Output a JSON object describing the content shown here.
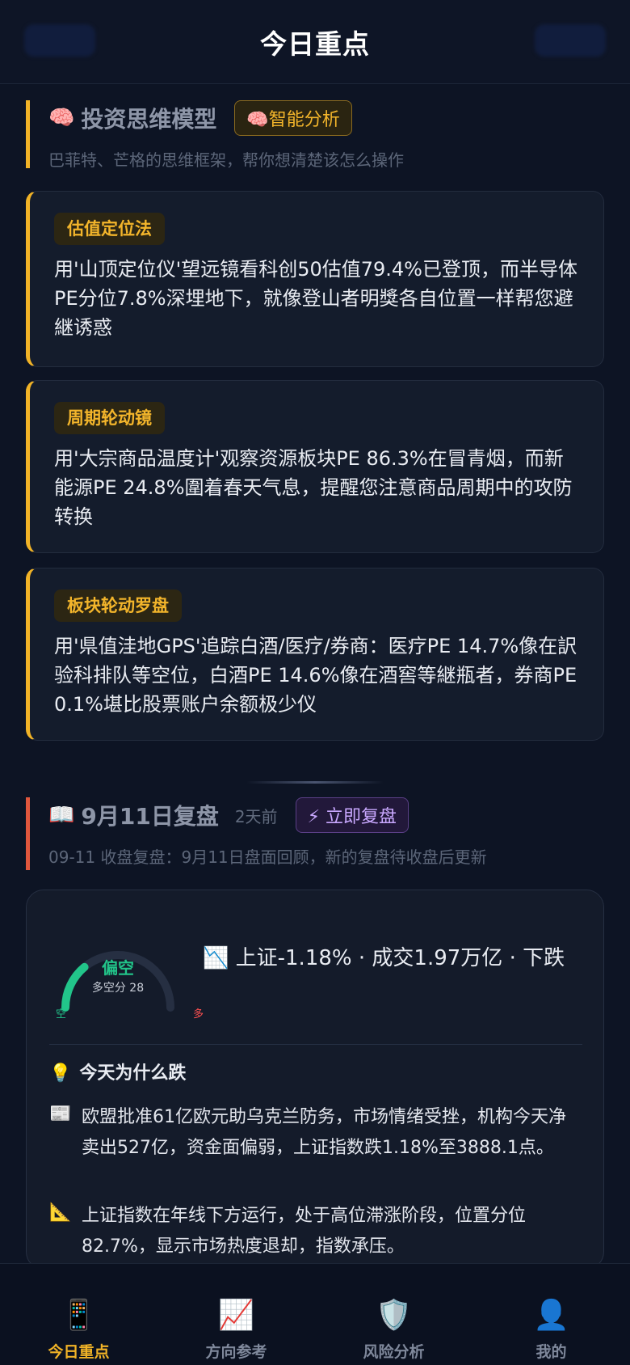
{
  "header": {
    "title": "今日重点"
  },
  "model_section": {
    "icon": "🧠",
    "title": "投资思维模型",
    "badge": "🧠智能分析",
    "subtitle": "巴菲特、芒格的思维框架，帮你想清楚该怎么操作",
    "accent_color": "#f1b327"
  },
  "models": [
    {
      "tag": "估值定位法",
      "text": "用'山顶定位仪'望远镜看科创50估值79.4%已登顶，而半导体PE分位7.8%深埋地下，就像登山者明獎各自位置一样帮您避継诱惑"
    },
    {
      "tag": "周期轮动镜",
      "text": "用'大宗商品温度计'观察资源板块PE 86.3%在冒青烟，而新能源PE 24.8%圍着春天气息，提醒您注意商品周期中的攻防转换"
    },
    {
      "tag": "板块轮动罗盘",
      "text": "用'県值洼地GPS'追踪白酒/医疗/券商：医疗PE 14.7%像在訳验科排队等空位，白酒PE 14.6%像在酒窖等継瓶者，券商PE 0.1%堪比股票账户余额极少仪"
    }
  ],
  "review_section": {
    "icon": "📖",
    "title": "9月11日复盘",
    "ago": "2天前",
    "button": "⚡ 立即复盘",
    "subtitle": "09-11 收盘复盘：9月11日盘面回顾，新的复盘待收盘后更新",
    "accent_color": "#e0573d"
  },
  "review": {
    "gauge": {
      "label": "偏空",
      "sub": "多空分 28",
      "value": 28,
      "left_label": "空",
      "right_label": "多"
    },
    "summary": "📉 上证-1.18% · 成交1.97万亿 · 下跌",
    "why_icon": "💡",
    "why_title": "今天为什么跌",
    "points": [
      {
        "icon": "📰",
        "text": "欧盟批准61亿欧元助乌克兰防务，市场情绪受挫，机构今天净卖出527亿，资金面偏弱，上证指数跌1.18%至3888.1点。"
      },
      {
        "icon": "📐",
        "text": "上证指数在年线下方运行，处于高位滞涨阶段，位置分位82.7%，显示市场热度退却，指数承压。"
      }
    ]
  },
  "nav": [
    {
      "icon": "📱",
      "label": "今日重点",
      "active": true
    },
    {
      "icon": "📈",
      "label": "方向参考",
      "active": false
    },
    {
      "icon": "🛡️",
      "label": "风险分析",
      "active": false
    },
    {
      "icon": "👤",
      "label": "我的",
      "active": false
    }
  ]
}
